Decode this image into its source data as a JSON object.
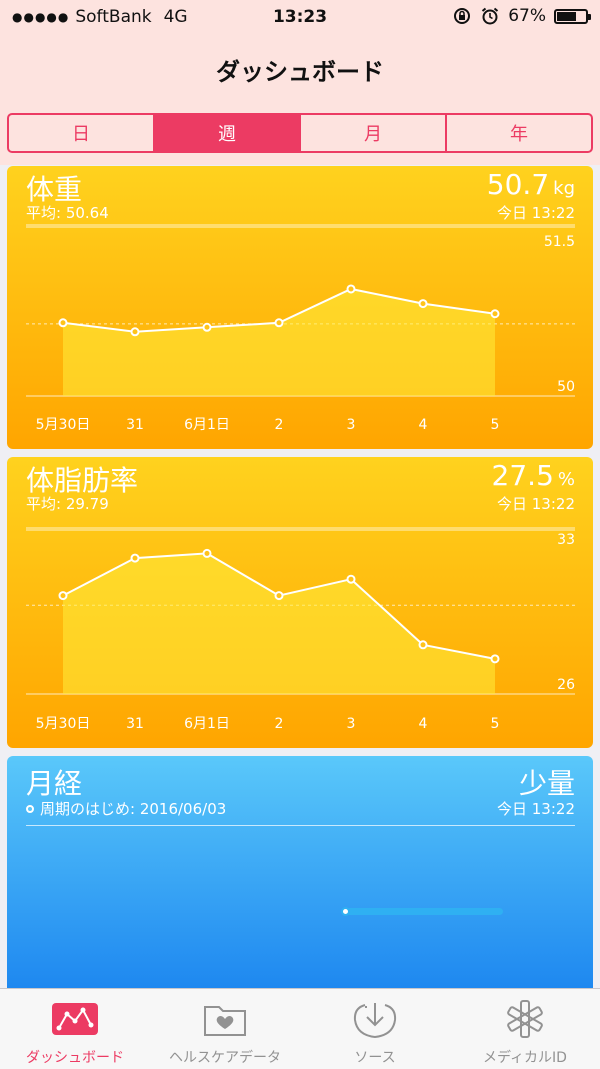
{
  "status_bar": {
    "signal_dots": "●●●●●",
    "carrier": "SoftBank",
    "network": "4G",
    "time": "13:23",
    "battery_percent": "67%",
    "battery_level": 0.67
  },
  "nav": {
    "title": "ダッシュボード"
  },
  "segments": [
    {
      "label": "日",
      "active": false
    },
    {
      "label": "週",
      "active": true
    },
    {
      "label": "月",
      "active": false
    },
    {
      "label": "年",
      "active": false
    }
  ],
  "weight_card": {
    "title": "体重",
    "value": "50.7",
    "unit": "kg",
    "average": "平均: 50.64",
    "timestamp": "今日 13:22",
    "chart_data": {
      "type": "line",
      "title": "体重",
      "categories": [
        "5月30日",
        "31",
        "6月1日",
        "2",
        "3",
        "4",
        "5"
      ],
      "values": [
        50.65,
        50.57,
        50.61,
        50.65,
        50.95,
        50.82,
        50.73
      ],
      "ylim": [
        50,
        51.5
      ],
      "y_ticks": [
        "51.5",
        "50"
      ],
      "average": 50.64
    }
  },
  "bodyfat_card": {
    "title": "体脂肪率",
    "value": "27.5",
    "unit": "%",
    "average": "平均: 29.79",
    "timestamp": "今日 13:22",
    "chart_data": {
      "type": "line",
      "title": "体脂肪率",
      "categories": [
        "5月30日",
        "31",
        "6月1日",
        "2",
        "3",
        "4",
        "5"
      ],
      "values": [
        30.2,
        31.8,
        32.0,
        30.2,
        30.9,
        28.1,
        27.5
      ],
      "ylim": [
        26,
        33
      ],
      "y_ticks": [
        "33",
        "26"
      ],
      "average": 29.79
    }
  },
  "cycle_card": {
    "title": "月経",
    "value": "少量",
    "start_label": "周期のはじめ: 2016/06/03",
    "timestamp": "今日 13:22"
  },
  "tabbar": [
    {
      "label": "ダッシュボード",
      "icon": "dashboard-icon",
      "active": true
    },
    {
      "label": "ヘルスケアデータ",
      "icon": "health-data-icon",
      "active": false
    },
    {
      "label": "ソース",
      "icon": "sources-icon",
      "active": false
    },
    {
      "label": "メディカルID",
      "icon": "medical-id-icon",
      "active": false
    }
  ],
  "colors": {
    "accent": "#ec3b63",
    "header_bg": "#fde3df",
    "card_yellow_top": "#ffd21e",
    "card_yellow_bottom": "#ffa500",
    "card_blue_top": "#5ac8fa",
    "card_blue_bottom": "#1e88f0"
  }
}
